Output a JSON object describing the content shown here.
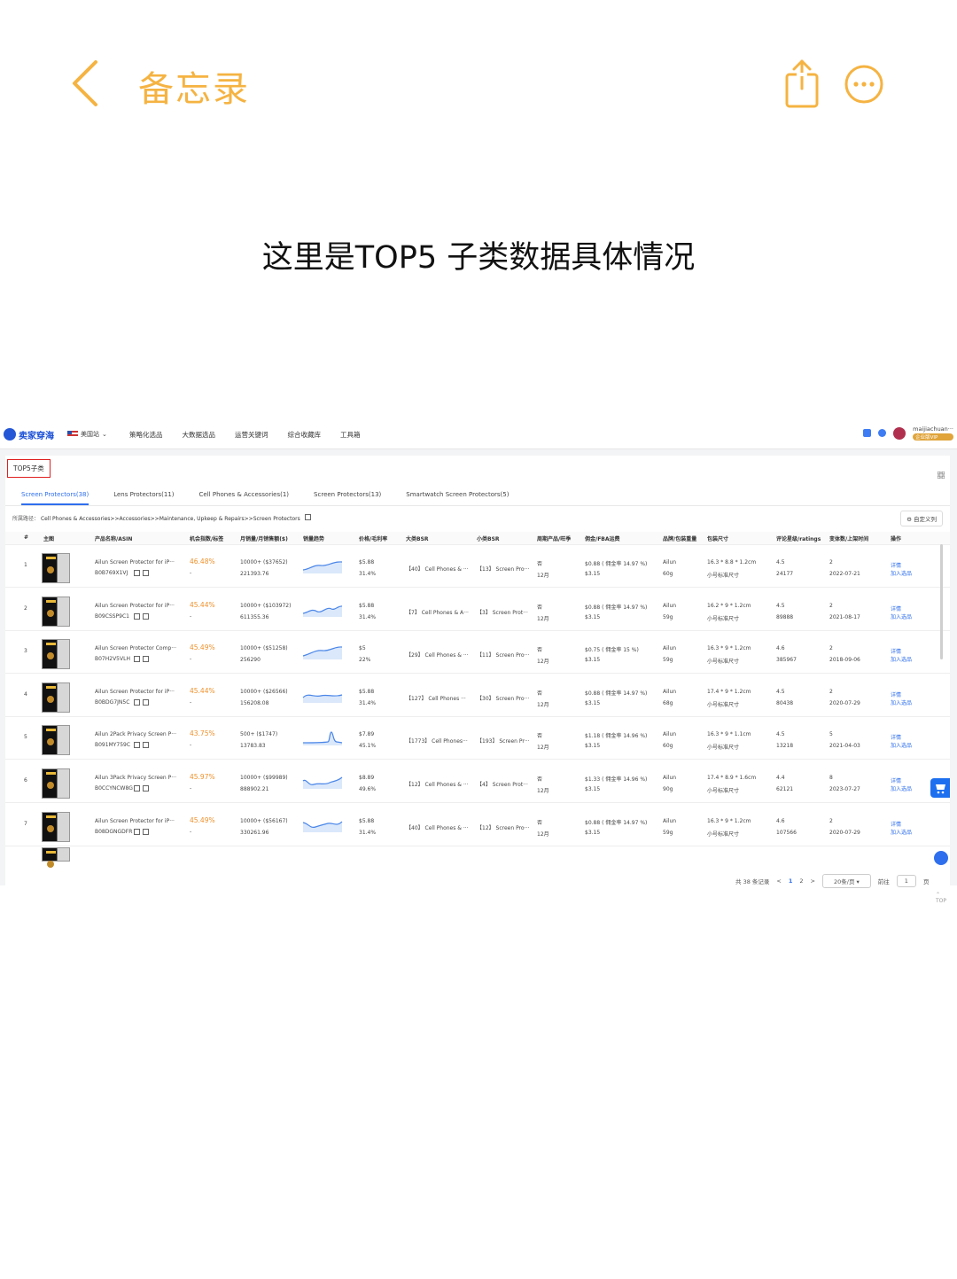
{
  "notes_app": {
    "title": "备忘录",
    "caption": "这里是TOP5 子类数据具体情况",
    "accent": "#f5b342"
  },
  "app": {
    "logo": "卖家穿海",
    "region": "美国站",
    "nav": [
      "策略化选品",
      "大数据选品",
      "运营关键词",
      "综合收藏库",
      "工具箱"
    ],
    "user": "maijiachuan···",
    "vip": "企业版VIP"
  },
  "section_label": "TOP5子类",
  "tabs": [
    "Screen Protectors(38)",
    "Lens Protectors(11)",
    "Cell Phones & Accessories(1)",
    "Screen Protectors(13)",
    "Smartwatch Screen Protectors(5)"
  ],
  "crumb": {
    "label": "所属路径：",
    "path": "Cell Phones & Accessories>>Accessories>>Maintenance, Upkeep & Repairs>>Screen Protectors"
  },
  "custom_columns": "自定义列",
  "columns": [
    "#",
    "主图",
    "产品名称/ASIN",
    "机会指数/标签",
    "月销量/月销售额($)",
    "销量趋势",
    "价格/毛利率",
    "大类BSR",
    "小类BSR",
    "周期产品/旺季",
    "佣金/FBA运费",
    "品牌/包装重量",
    "包装尺寸",
    "评论星级/ratings",
    "变体数/上架时间",
    "操作"
  ],
  "rows": [
    {
      "idx": "1",
      "name": "Ailun Screen Protector for iP···",
      "asin": "B0B769X1VJ",
      "score": "46.48%",
      "dash": "-",
      "sales": "10000+ ($37652)",
      "revenue": "221393.76",
      "price": "$5.88",
      "margin": "31.4%",
      "bsr_big": "【40】 Cell Phones & ···",
      "bsr_small": "【13】 Screen Pro···",
      "cycle": "否",
      "month": "12月",
      "commission": "$0.88 ( 佣金率 14.97 %)",
      "fba": "$3.15",
      "brand": "Ailun",
      "weight": "60g",
      "size": "16.3 * 8.8 * 1.2cm",
      "size_tag": "小号标准尺寸",
      "rating": "4.5",
      "ratings": "24177",
      "variants": "2",
      "date": "2022-07-21",
      "act1": "详情",
      "act2": "加入选品"
    },
    {
      "idx": "2",
      "name": "Ailun Screen Protector for iP···",
      "asin": "B09CSSP9C1",
      "score": "45.44%",
      "dash": "-",
      "sales": "10000+ ($103972)",
      "revenue": "611355.36",
      "price": "$5.88",
      "margin": "31.4%",
      "bsr_big": "【7】 Cell Phones & A···",
      "bsr_small": "【3】 Screen Prot···",
      "cycle": "否",
      "month": "12月",
      "commission": "$0.88 ( 佣金率 14.97 %)",
      "fba": "$3.15",
      "brand": "Ailun",
      "weight": "59g",
      "size": "16.2 * 9 * 1.2cm",
      "size_tag": "小号标准尺寸",
      "rating": "4.5",
      "ratings": "89888",
      "variants": "2",
      "date": "2021-08-17",
      "act1": "详情",
      "act2": "加入选品"
    },
    {
      "idx": "3",
      "name": "Ailun Screen Protector Comp···",
      "asin": "B07H2V5VLH",
      "score": "45.49%",
      "dash": "-",
      "sales": "10000+ ($51258)",
      "revenue": "256290",
      "price": "$5",
      "margin": "22%",
      "bsr_big": "【29】 Cell Phones & ···",
      "bsr_small": "【11】 Screen Pro···",
      "cycle": "否",
      "month": "12月",
      "commission": "$0.75 ( 佣金率 15 %)",
      "fba": "$3.15",
      "brand": "Ailun",
      "weight": "59g",
      "size": "16.3 * 9 * 1.2cm",
      "size_tag": "小号标准尺寸",
      "rating": "4.6",
      "ratings": "385967",
      "variants": "2",
      "date": "2018-09-06",
      "act1": "详情",
      "act2": "加入选品"
    },
    {
      "idx": "4",
      "name": "Ailun Screen Protector for iP···",
      "asin": "B0BDG7JN5C",
      "score": "45.44%",
      "dash": "-",
      "sales": "10000+ ($26566)",
      "revenue": "156208.08",
      "price": "$5.88",
      "margin": "31.4%",
      "bsr_big": "【127】 Cell Phones ···",
      "bsr_small": "【30】 Screen Pro···",
      "cycle": "否",
      "month": "12月",
      "commission": "$0.88 ( 佣金率 14.97 %)",
      "fba": "$3.15",
      "brand": "Ailun",
      "weight": "68g",
      "size": "17.4 * 9 * 1.2cm",
      "size_tag": "小号标准尺寸",
      "rating": "4.5",
      "ratings": "80438",
      "variants": "2",
      "date": "2020-07-29",
      "act1": "详情",
      "act2": "加入选品"
    },
    {
      "idx": "5",
      "name": "Ailun 2Pack Privacy Screen P···",
      "asin": "B091MY759C",
      "score": "43.75%",
      "dash": "-",
      "sales": "500+ ($1747)",
      "revenue": "13783.83",
      "price": "$7.89",
      "margin": "45.1%",
      "bsr_big": "【1773】 Cell Phones···",
      "bsr_small": "【193】 Screen Pr···",
      "cycle": "否",
      "month": "12月",
      "commission": "$1.18 ( 佣金率 14.96 %)",
      "fba": "$3.15",
      "brand": "Ailun",
      "weight": "60g",
      "size": "16.3 * 9 * 1.1cm",
      "size_tag": "小号标准尺寸",
      "rating": "4.5",
      "ratings": "13218",
      "variants": "5",
      "date": "2021-04-03",
      "act1": "详情",
      "act2": "加入选品"
    },
    {
      "idx": "6",
      "name": "Ailun 3Pack Privacy Screen P···",
      "asin": "B0CCYNCW8G",
      "score": "45.97%",
      "dash": "-",
      "sales": "10000+ ($99989)",
      "revenue": "888902.21",
      "price": "$8.89",
      "margin": "49.6%",
      "bsr_big": "【12】 Cell Phones & ···",
      "bsr_small": "【4】 Screen Prot···",
      "cycle": "否",
      "month": "12月",
      "commission": "$1.33 ( 佣金率 14.96 %)",
      "fba": "$3.15",
      "brand": "Ailun",
      "weight": "90g",
      "size": "17.4 * 8.9 * 1.6cm",
      "size_tag": "小号标准尺寸",
      "rating": "4.4",
      "ratings": "62121",
      "variants": "8",
      "date": "2023-07-27",
      "act1": "详情",
      "act2": "加入选品"
    },
    {
      "idx": "7",
      "name": "Ailun Screen Protector for iP···",
      "asin": "B08DGNGDFR",
      "score": "45.49%",
      "dash": "-",
      "sales": "10000+ ($56167)",
      "revenue": "330261.96",
      "price": "$5.88",
      "margin": "31.4%",
      "bsr_big": "【40】 Cell Phones & ···",
      "bsr_small": "【12】 Screen Pro···",
      "cycle": "否",
      "month": "12月",
      "commission": "$0.88 ( 佣金率 14.97 %)",
      "fba": "$3.15",
      "brand": "Ailun",
      "weight": "59g",
      "size": "16.3 * 9 * 1.2cm",
      "size_tag": "小号标准尺寸",
      "rating": "4.6",
      "ratings": "107566",
      "variants": "2",
      "date": "2020-07-29",
      "act1": "详情",
      "act2": "加入选品"
    }
  ],
  "pager": {
    "total": "共 38 条记录",
    "prev": "<",
    "page1": "1",
    "page2": "2",
    "next": ">",
    "per_page": "20条/页",
    "goto": "前往",
    "goto_value": "1",
    "page_suffix": "页"
  },
  "top_label": "TOP"
}
